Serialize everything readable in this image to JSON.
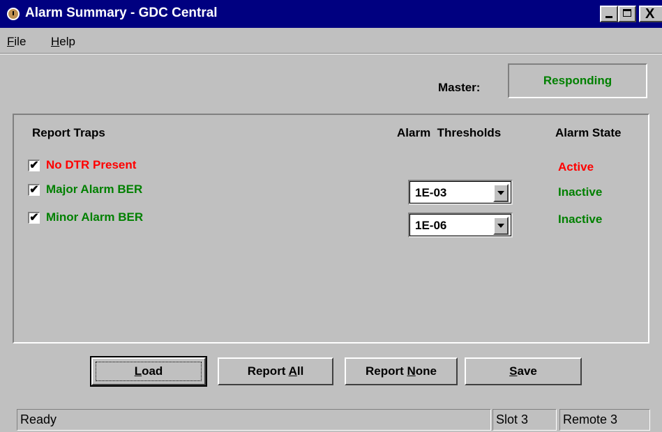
{
  "window": {
    "title": "Alarm Summary - GDC Central",
    "close_glyph": "X"
  },
  "menu": {
    "file": {
      "accel": "F",
      "rest": "ile"
    },
    "help": {
      "accel": "H",
      "rest": "elp"
    }
  },
  "master": {
    "label": "Master:",
    "status": "Responding",
    "status_color": "#008000"
  },
  "headers": {
    "report_traps": "Report Traps",
    "alarm_thresholds": "Alarm  Thresholds",
    "alarm_state": "Alarm State"
  },
  "traps": [
    {
      "label": "No DTR Present",
      "checked": true,
      "check_glyph": "✔",
      "color": "#ff0000",
      "state": "Active"
    },
    {
      "label": "Major Alarm BER",
      "checked": true,
      "check_glyph": "✔",
      "color": "#008000",
      "state": "Inactive",
      "threshold": "1E-03"
    },
    {
      "label": "Minor Alarm BER",
      "checked": true,
      "check_glyph": "✔",
      "color": "#008000",
      "state": "Inactive",
      "threshold": "1E-06"
    }
  ],
  "buttons": {
    "load": {
      "pre": "",
      "accel": "L",
      "post": "oad"
    },
    "report_all": {
      "pre": "Report ",
      "accel": "A",
      "post": "ll"
    },
    "report_none": {
      "pre": "Report ",
      "accel": "N",
      "post": "one"
    },
    "save": {
      "pre": "",
      "accel": "S",
      "post": "ave"
    }
  },
  "statusbar": {
    "message": "Ready",
    "slot": "Slot 3",
    "remote": "Remote 3"
  },
  "colors": {
    "title_bar": "#000080",
    "face": "#c0c0c0",
    "active": "#ff0000",
    "inactive": "#008000"
  }
}
